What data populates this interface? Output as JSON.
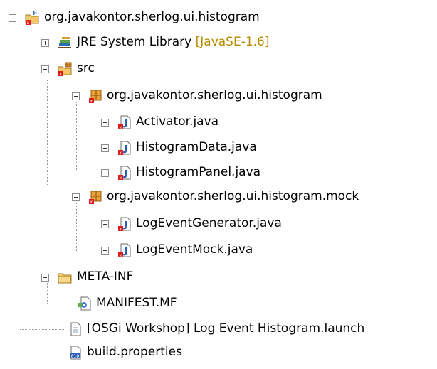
{
  "tree": {
    "project": "org.javakontor.sherlog.ui.histogram",
    "jre_label": "JRE System Library",
    "jre_version": "[JavaSE-1.6]",
    "src": "src",
    "pkg1": "org.javakontor.sherlog.ui.histogram",
    "activator": "Activator.java",
    "histogram_data": "HistogramData.java",
    "histogram_panel": "HistogramPanel.java",
    "pkg2": "org.javakontor.sherlog.ui.histogram.mock",
    "log_event_generator": "LogEventGenerator.java",
    "log_event_mock": "LogEventMock.java",
    "meta_inf": "META-INF",
    "manifest": "MANIFEST.MF",
    "launch_file": "[OSGi Workshop] Log Event Histogram.launch",
    "build_properties": "build.properties"
  },
  "icons": {
    "project": "java-project-icon",
    "library": "library-icon",
    "source_folder": "source-folder-icon",
    "package": "package-icon",
    "java_file": "java-file-icon",
    "folder": "folder-icon",
    "manifest": "manifest-icon",
    "launch": "launch-file-icon",
    "properties": "properties-file-icon"
  },
  "colors": {
    "error_marker": "#e01b1b",
    "version_text": "#b78b00",
    "tree_lines": "#9a9a9a"
  }
}
